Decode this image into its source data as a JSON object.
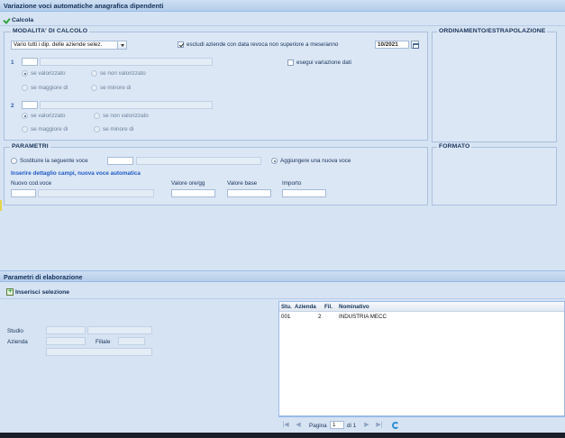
{
  "window": {
    "title": "Variazione voci automatiche anagrafica dipendenti"
  },
  "toolbar": {
    "calcola_label": "Calcola",
    "inserisci_label": "Inserisci selezione"
  },
  "modalita": {
    "legend": "Modalita' di calcolo",
    "combo_value": "Vario tutti i dip. delle aziende selez.",
    "escludi_label": "escludi aziende con data revoca non superiore a mese/anno",
    "date_value": "10/2021",
    "esegui_label": "esegui variazione dati",
    "block1": {
      "num": "1",
      "r1a": "se valorizzato",
      "r1b": "se non valorizzato",
      "r2a": "se maggiore di",
      "r2b": "se minore di"
    },
    "block2": {
      "num": "2",
      "r1a": "se valorizzato",
      "r1b": "se non valorizzato",
      "r2a": "se maggiore di",
      "r2b": "se minore di"
    }
  },
  "ordinamento": {
    "legend": "Ordinamento/Estrapolazione"
  },
  "formato": {
    "legend": "Formato"
  },
  "parametri": {
    "legend": "Parametri",
    "sostituire_label": "Sostituire la seguente voce",
    "aggiungere_label": "Aggiungere una nuova voce",
    "dettaglio_label": "Inserire dettaglio campi, nuova voce automatica",
    "nuovo_label": "Nuovo cod.voce",
    "ore_label": "Valore ore/gg",
    "base_label": "Valore base",
    "importo_label": "Importo"
  },
  "elaborazione": {
    "title": "Parametri di elaborazione",
    "studio_label": "Studio",
    "azienda_label": "Azienda",
    "filiale_label": "Filiale"
  },
  "grid": {
    "columns": [
      "Stu.",
      "Azienda",
      "Fil.",
      "Nominativo"
    ],
    "rows": [
      {
        "stu": "001",
        "azienda": "2",
        "fil": "",
        "nominativo": "INDUSTRIA MECC"
      }
    ]
  },
  "pager": {
    "pagina_label": "Pagina",
    "page": "1",
    "of_label": "di 1"
  }
}
